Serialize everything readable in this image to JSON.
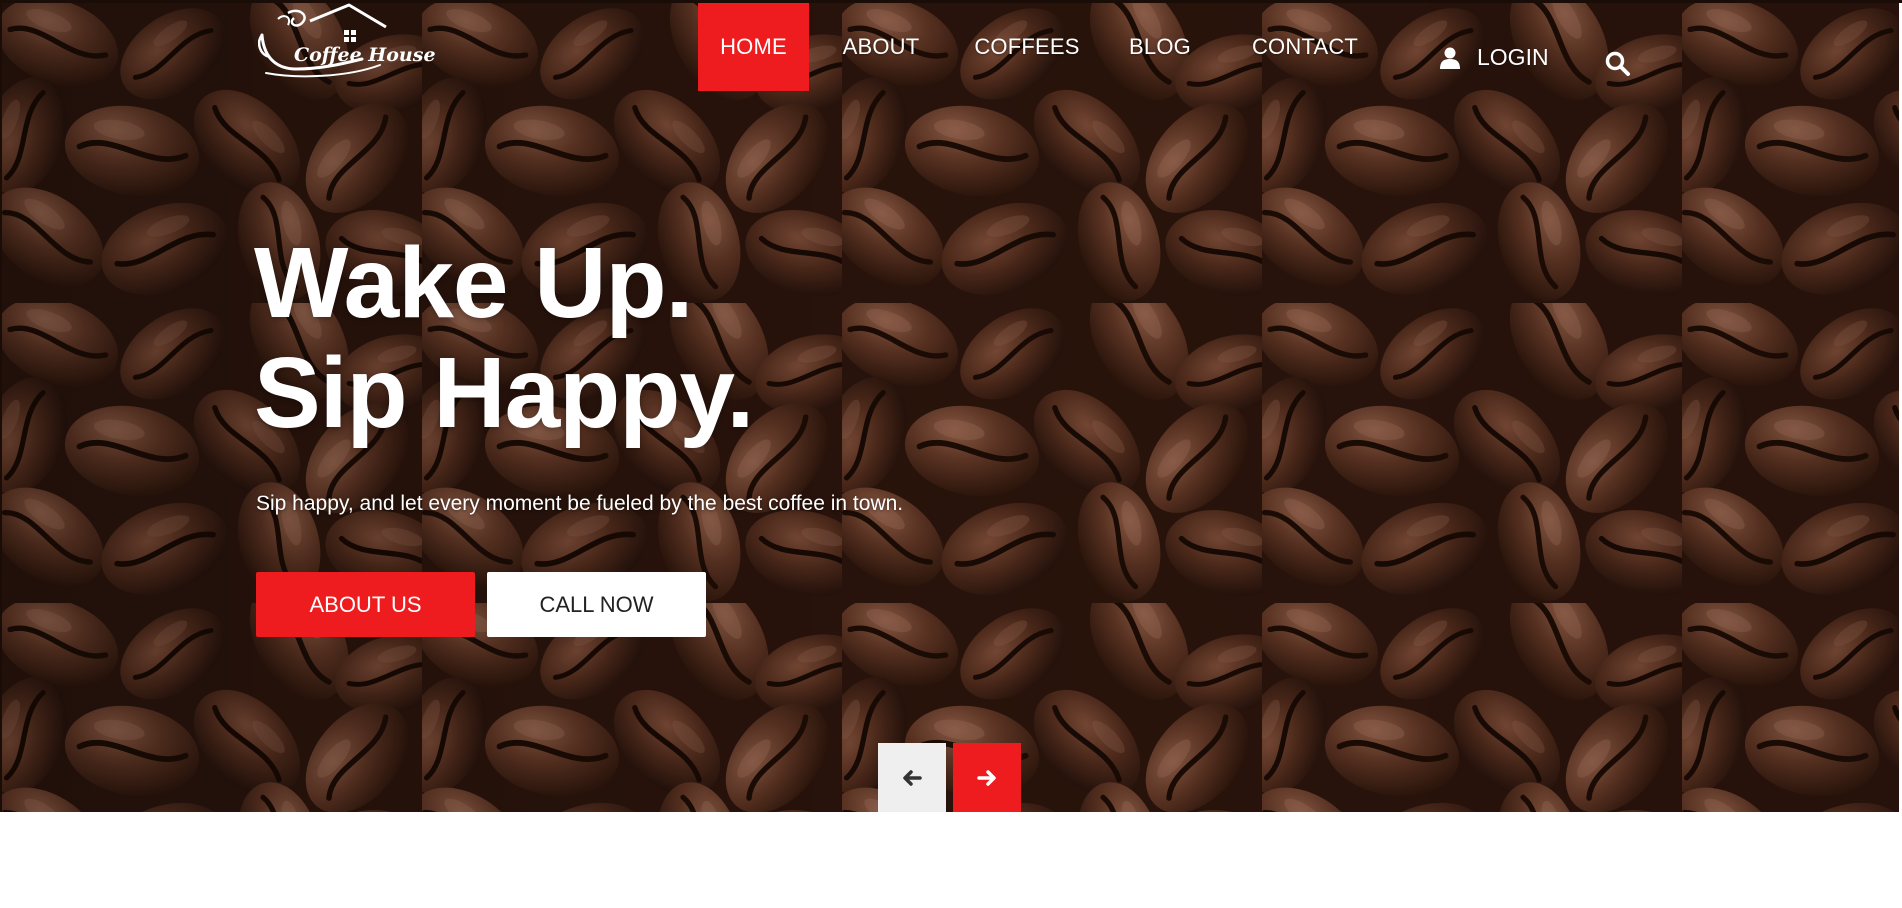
{
  "brand": {
    "logo_text": "Coffee House"
  },
  "nav": {
    "items": [
      {
        "label": "HOME",
        "active": true
      },
      {
        "label": "ABOUT",
        "active": false
      },
      {
        "label": "COFFEES",
        "active": false
      },
      {
        "label": "BLOG",
        "active": false
      },
      {
        "label": "CONTACT",
        "active": false
      }
    ],
    "login_label": "LOGIN"
  },
  "hero": {
    "headline_line1": "Wake Up.",
    "headline_line2": "Sip Happy.",
    "subtitle": "Sip happy, and let every moment be fueled by the best coffee in town.",
    "primary_button": "ABOUT US",
    "secondary_button": "CALL NOW",
    "background": "coffee-beans-photo"
  },
  "slider": {
    "prev_icon": "arrow-left-icon",
    "next_icon": "arrow-right-icon"
  },
  "icons": {
    "logo": "coffee-cup-house-logo",
    "user": "user-icon",
    "search": "search-icon"
  },
  "colors": {
    "accent": "#ee1c1f",
    "text_light": "#ffffff",
    "button_light_bg": "#ffffff",
    "prev_button_bg": "#efefef",
    "hero_base": "#2a140c"
  }
}
